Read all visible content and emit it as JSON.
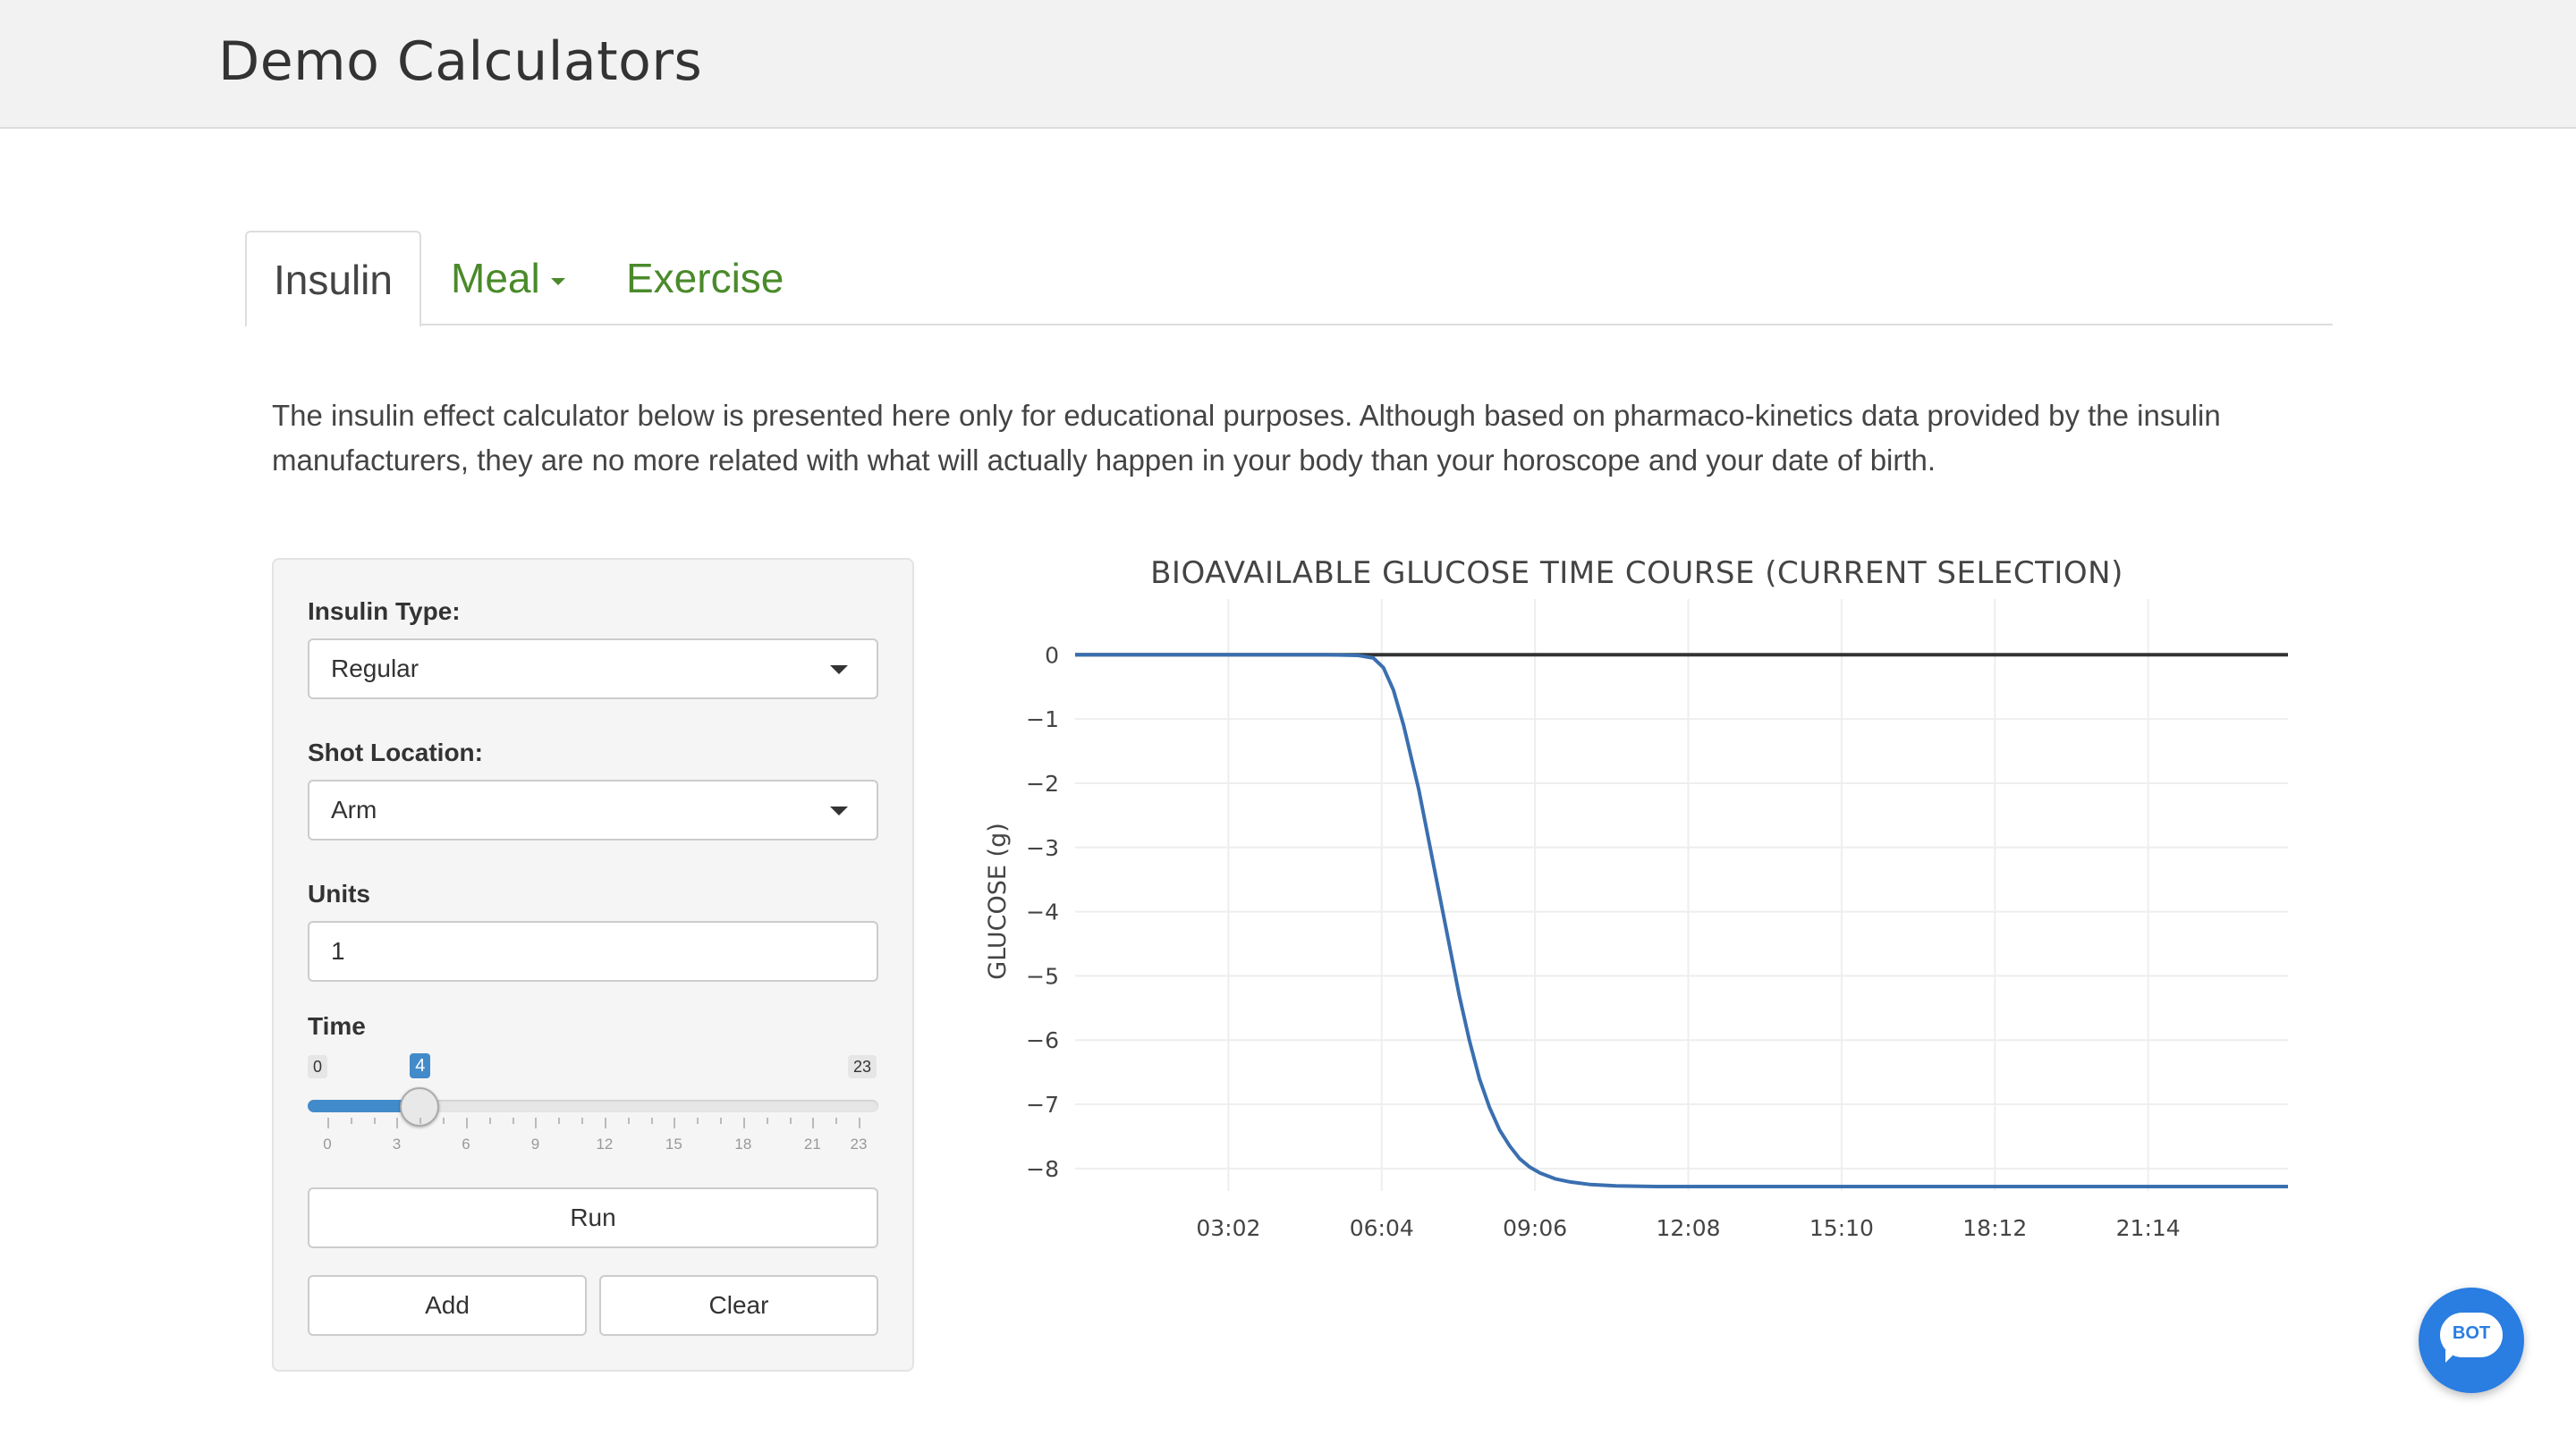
{
  "navbar": {
    "brand": "Demo Calculators"
  },
  "tabs": [
    {
      "label": "Insulin",
      "active": true
    },
    {
      "label": "Meal",
      "has_dropdown": true
    },
    {
      "label": "Exercise"
    }
  ],
  "description": "The insulin effect calculator below is presented here only for educational purposes. Although based on pharmaco-kinetics data provided by the insulin manufacturers, they are no more related with what will actually happen in your body than your horoscope and your date of birth.",
  "form": {
    "insulin_type": {
      "label": "Insulin Type:",
      "value": "Regular"
    },
    "shot_location": {
      "label": "Shot Location:",
      "value": "Arm"
    },
    "units": {
      "label": "Units",
      "value": "1"
    },
    "time": {
      "label": "Time",
      "min": 0,
      "max": 23,
      "value": 4,
      "min_label": "0",
      "max_label": "23",
      "value_label": "4",
      "tick_labels": [
        "0",
        "3",
        "6",
        "9",
        "12",
        "15",
        "18",
        "21",
        "23"
      ]
    },
    "buttons": {
      "run": "Run",
      "add": "Add",
      "clear": "Clear"
    }
  },
  "chart_data": {
    "type": "line",
    "title": "BIOAVAILABLE GLUCOSE TIME COURSE (CURRENT SELECTION)",
    "xlabel": "",
    "ylabel": "GLUCOSE (g)",
    "x_tick_labels": [
      "03:02",
      "06:04",
      "09:06",
      "12:08",
      "15:10",
      "18:12",
      "21:14"
    ],
    "x_tick_hours": [
      3.033,
      6.067,
      9.1,
      12.133,
      15.167,
      18.2,
      21.233
    ],
    "xlim_hours": [
      0,
      24
    ],
    "y_ticks": [
      0,
      -1,
      -2,
      -3,
      -4,
      -5,
      -6,
      -7,
      -8
    ],
    "y_tick_labels": [
      "0",
      "−1",
      "−2",
      "−3",
      "−4",
      "−5",
      "−6",
      "−7",
      "−8"
    ],
    "ylim": [
      -8.35,
      0.45
    ],
    "grid": true,
    "series": [
      {
        "color": "#3a6fb0",
        "x_hours": [
          0,
          5,
          5.6,
          5.9,
          6.1,
          6.3,
          6.5,
          6.8,
          7.0,
          7.2,
          7.4,
          7.6,
          7.8,
          8.0,
          8.2,
          8.4,
          8.6,
          8.8,
          9.0,
          9.2,
          9.5,
          9.8,
          10.2,
          10.7,
          11.5,
          12.5,
          14,
          16,
          18,
          20,
          22,
          24
        ],
        "values": [
          0,
          0,
          -0.01,
          -0.05,
          -0.2,
          -0.55,
          -1.1,
          -2.1,
          -2.9,
          -3.7,
          -4.5,
          -5.3,
          -6.0,
          -6.6,
          -7.05,
          -7.4,
          -7.65,
          -7.85,
          -7.98,
          -8.07,
          -8.16,
          -8.21,
          -8.25,
          -8.27,
          -8.28,
          -8.28,
          -8.28,
          -8.28,
          -8.28,
          -8.28,
          -8.28,
          -8.28
        ]
      },
      {
        "color": "#333333",
        "x_hours": [
          0,
          24
        ],
        "values": [
          0,
          0
        ]
      }
    ]
  },
  "bot": {
    "label": "BOT",
    "accent": "#2a7de1"
  }
}
